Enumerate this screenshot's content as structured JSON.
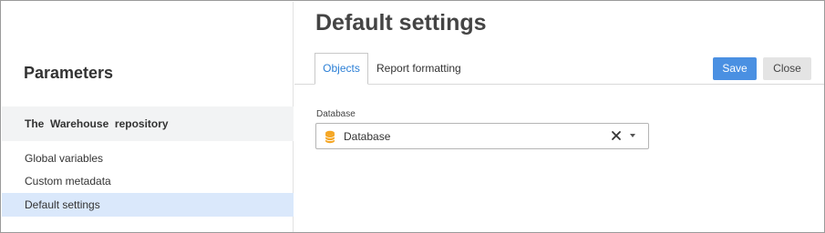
{
  "sidebar": {
    "title": "Parameters",
    "repository": "The  Warehouse  repository",
    "items": [
      {
        "label": "Global variables",
        "active": false
      },
      {
        "label": "Custom metadata",
        "active": false
      },
      {
        "label": "Default settings",
        "active": true
      }
    ]
  },
  "main": {
    "title": "Default settings",
    "tabs": [
      {
        "label": "Objects",
        "active": true
      },
      {
        "label": "Report formatting",
        "active": false
      }
    ],
    "buttons": {
      "save": "Save",
      "close": "Close"
    },
    "field": {
      "label": "Database",
      "value": "Database",
      "icon": "database-icon"
    }
  },
  "colors": {
    "accent": "#4a90e2",
    "active_tab_text": "#2b7fd6",
    "selected_item_bg": "#dae8fb",
    "db_icon": "#f5a623"
  }
}
